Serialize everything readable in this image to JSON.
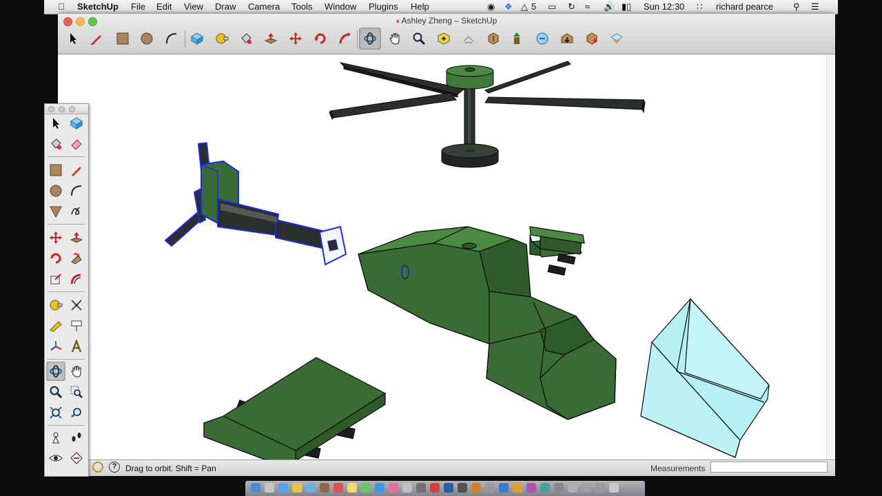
{
  "menubar": {
    "app_name": "SketchUp",
    "items": [
      "File",
      "Edit",
      "View",
      "Draw",
      "Camera",
      "Tools",
      "Window",
      "Plugins",
      "Help"
    ],
    "adobe_count": "5",
    "clock": "Sun 12:30",
    "user": "richard pearce"
  },
  "window": {
    "title": "Ashley Zheng – SketchUp"
  },
  "toolbar": {
    "tools": [
      "select-tool",
      "pencil-tool",
      "rectangle-tool",
      "circle-tool",
      "arc-tool",
      "make-component-tool",
      "tape-measure-tool",
      "paint-bucket-tool",
      "push-pull-tool",
      "move-tool",
      "rotate-tool",
      "follow-me-tool",
      "orbit-tool",
      "pan-tool",
      "zoom-tool",
      "zoom-extents-tool",
      "previous-view-tool",
      "get-models-tool",
      "share-model-tool",
      "share-component-tool",
      "extension-warehouse-tool",
      "send-to-layout-tool",
      "preview-3d-tool"
    ],
    "active": "orbit-tool"
  },
  "palette": {
    "tools": [
      "select",
      "make-component",
      "paint-bucket",
      "eraser",
      "rectangle",
      "pencil",
      "circle",
      "arc",
      "polygon",
      "freehand",
      "move",
      "push-pull",
      "rotate",
      "follow-me",
      "scale",
      "offset",
      "tape-measure",
      "dimension",
      "protractor",
      "text",
      "axes",
      "3d-text",
      "orbit",
      "pan",
      "zoom",
      "zoom-window",
      "zoom-extents",
      "zoom-previous",
      "position-camera",
      "walk",
      "look-around",
      "section-plane"
    ],
    "active": "orbit"
  },
  "status": {
    "hint": "Drag to orbit.  Shift = Pan",
    "measurements_label": "Measurements",
    "measurements_value": ""
  },
  "colors": {
    "model_green": "#3a6b34",
    "rotor_dark": "#2b2f2b",
    "selection_blue": "#1a2ce0",
    "glass": "#a8eef2"
  }
}
